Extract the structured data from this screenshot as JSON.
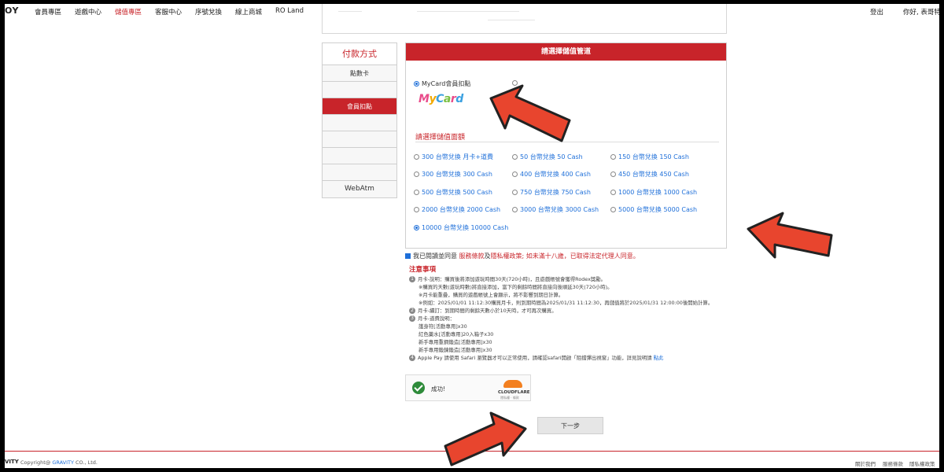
{
  "nav": {
    "logo": "OY",
    "items": [
      "會員專區",
      "遊戲中心",
      "儲值專區",
      "客服中心",
      "序號兌換",
      "線上商城",
      "RO Land"
    ],
    "active_index": 2,
    "logout": "登出",
    "greeting": "你好, 表哥特"
  },
  "payment_methods": {
    "title": "付款方式",
    "items": [
      "點數卡",
      "",
      "會員扣點",
      "",
      "",
      "",
      "",
      "WebAtm"
    ],
    "active_index": 2
  },
  "panel": {
    "header": "請選擇儲值管道",
    "channel_mycard": "MyCard會員扣點",
    "mycard_logo": "MyCard",
    "amount_title": "請選擇儲值面額",
    "options": [
      {
        "pre": "300 台幣兌換 ",
        "blue": "月卡+道費",
        "selected": false
      },
      {
        "pre": "50 台幣兌換 ",
        "blue": "50 Cash",
        "selected": false
      },
      {
        "pre": "150 台幣兌換 ",
        "blue": "150 Cash",
        "selected": false
      },
      {
        "pre": "300 台幣兌換 ",
        "blue": "300 Cash",
        "selected": false
      },
      {
        "pre": "400 台幣兌換 ",
        "blue": "400 Cash",
        "selected": false
      },
      {
        "pre": "450 台幣兌換 ",
        "blue": "450 Cash",
        "selected": false
      },
      {
        "pre": "500 台幣兌換 ",
        "blue": "500 Cash",
        "selected": false
      },
      {
        "pre": "750 台幣兌換 ",
        "blue": "750 Cash",
        "selected": false
      },
      {
        "pre": "1000 台幣兌換 ",
        "blue": "1000 Cash",
        "selected": false
      },
      {
        "pre": "2000 台幣兌換 ",
        "blue": "2000 Cash",
        "selected": false
      },
      {
        "pre": "3000 台幣兌換 ",
        "blue": "3000 Cash",
        "selected": false
      },
      {
        "pre": "5000 台幣兌換 ",
        "blue": "5000 Cash",
        "selected": false
      },
      {
        "pre": "10000 台幣兌換 ",
        "blue": "10000 Cash",
        "selected": true
      }
    ]
  },
  "agreement": {
    "pre": "我已閱讀並同意 ",
    "link1": "服務條款",
    "mid": "及",
    "link2": "隱私權政策",
    "post": "; 如未滿十八歲，已取得法定代理人同意。"
  },
  "notes": {
    "title": "注意事項",
    "items": [
      {
        "num": "1",
        "lines": [
          "月卡-說明：購買後將添加遊玩時間30天(720小時)，且遊戲帳號會獲得Rodex獎勵。",
          "※購買的天數(遊玩時數)將直接添加，當下的剩餘時間將直接向後順延30天(720小時)。",
          "※月卡能重疊，購買的遊戲帳號上會顯示，將不影響到期日計算。",
          "※例如：2025/01/01 11:12:30購買月卡，則到期時間為2025/01/31 11:12:30，再儲值將於2025/01/31 12:00:00後開始計算。"
        ]
      },
      {
        "num": "2",
        "lines": [
          "月卡-續訂：到期時間的剩餘天數小於10天時，才可再次購買。"
        ]
      },
      {
        "num": "3",
        "lines": [
          "月卡-道費說明：",
          "護身符[活動專用]x30",
          "紅色藥水[活動專用]20入箱子x30",
          "新手專用重鋼鍛造[活動專用]x30",
          "新手專用鍛鍊鍛造[活動專用]x30"
        ]
      },
      {
        "num": "4",
        "lines": [
          "Apple Pay 請使用 Safari 瀏覽器才可以正常使用，請確認safari開啟「阻擋彈出視窗」功能，詳見說明請 "
        ],
        "link": "點此"
      }
    ]
  },
  "captcha": {
    "status": "成功!",
    "brand": "CLOUDFLARE",
    "small": "隱私權 · 條款"
  },
  "next_button": "下一步",
  "footer": {
    "logo": "VITY",
    "copyright_pre": "Copyright@ ",
    "company": "GRAVITY",
    "copyright_post": " CO., Ltd.",
    "links": [
      "關於我們",
      "服務條款",
      "隱私權政策"
    ]
  },
  "colors": {
    "brand_red": "#c8242a",
    "link_blue": "#1e6fd9",
    "arrow_red": "#e8452e"
  }
}
